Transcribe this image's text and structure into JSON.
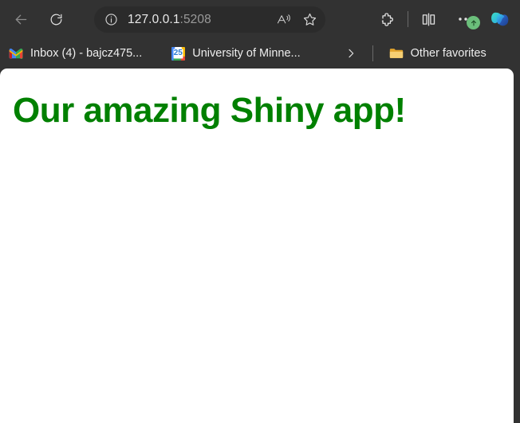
{
  "browser": {
    "toolbar": {
      "back_button": "Back",
      "reload_button": "Refresh",
      "site_info_icon": "info-circle-icon",
      "url_host": "127.0.0.1",
      "url_port": ":5208",
      "url_full": "127.0.0.1:5208",
      "read_aloud_button": "Read aloud",
      "favorite_button": "Add this page to favorites",
      "extensions_button": "Extensions",
      "split_screen_button": "Split screen",
      "more_button": "Settings and more",
      "update_badge": "Update available",
      "copilot_button": "Copilot"
    },
    "bookmarks": {
      "items": [
        {
          "label": "Inbox (4) - bajcz475...",
          "icon": "gmail-icon"
        },
        {
          "label": "University of Minne...",
          "icon": "google-calendar-icon",
          "badge": "25"
        }
      ],
      "overflow_button": "Show more bookmarks",
      "other_favorites": {
        "label": "Other favorites",
        "icon": "folder-icon"
      }
    }
  },
  "page": {
    "heading": "Our amazing Shiny app!",
    "heading_color": "#008000",
    "background_color": "#ffffff"
  }
}
